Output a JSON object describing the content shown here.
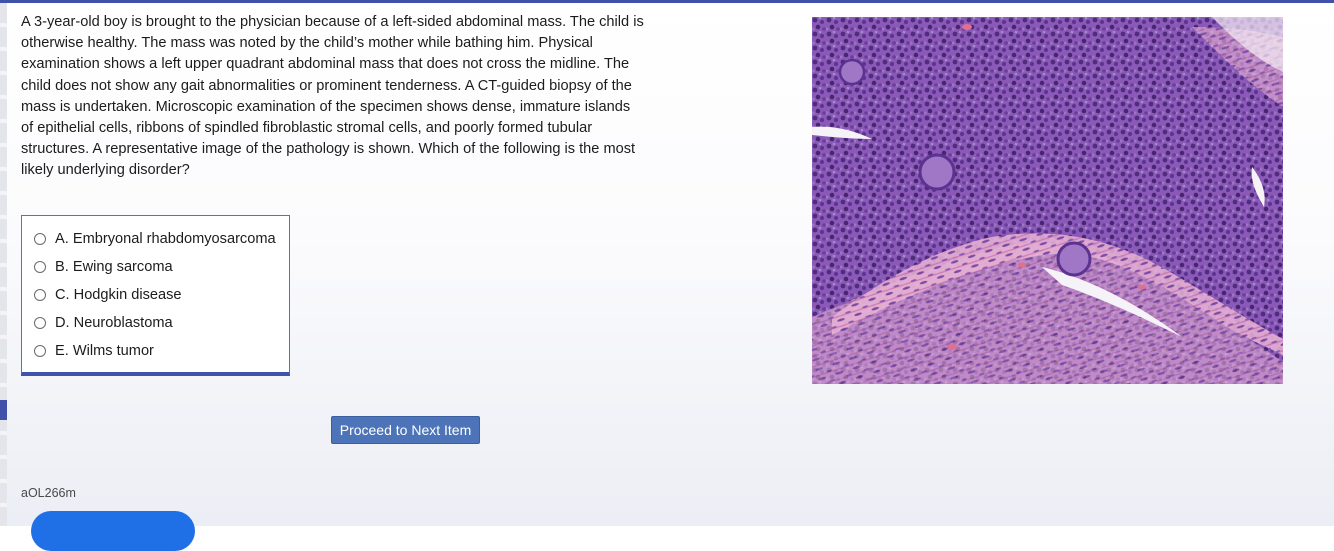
{
  "question": {
    "stem": "A 3-year-old boy is brought to the physician because of a left-sided abdominal mass. The child is otherwise healthy. The mass was noted by the child’s mother while bathing him. Physical examination shows a left upper quadrant abdominal mass that does not cross the midline. The child does not show any gait abnormalities or prominent tenderness. A CT-guided biopsy of the mass is undertaken. Microscopic examination of the specimen shows dense, immature islands of epithelial cells, ribbons of spindled fibroblastic stromal cells, and poorly formed tubular structures. A representative image of the pathology is shown. Which of the following is the most likely underlying disorder?",
    "choices": [
      {
        "label": "A. Embryonal rhabdomyosarcoma",
        "selected": false
      },
      {
        "label": "B. Ewing sarcoma",
        "selected": false
      },
      {
        "label": "C. Hodgkin disease",
        "selected": false
      },
      {
        "label": "D. Neuroblastoma",
        "selected": false
      },
      {
        "label": "E. Wilms tumor",
        "selected": false
      }
    ]
  },
  "actions": {
    "next_label": "Proceed to Next Item"
  },
  "footer": {
    "item_id": "aOL266m"
  },
  "image": {
    "description_icon": "histology-micrograph-image"
  },
  "colors": {
    "accent": "#3f51a8",
    "button": "#4d74b8",
    "pill": "#1f6fe6",
    "stain_purple": "#7d4aa8",
    "stain_pink": "#e7a6cc"
  }
}
